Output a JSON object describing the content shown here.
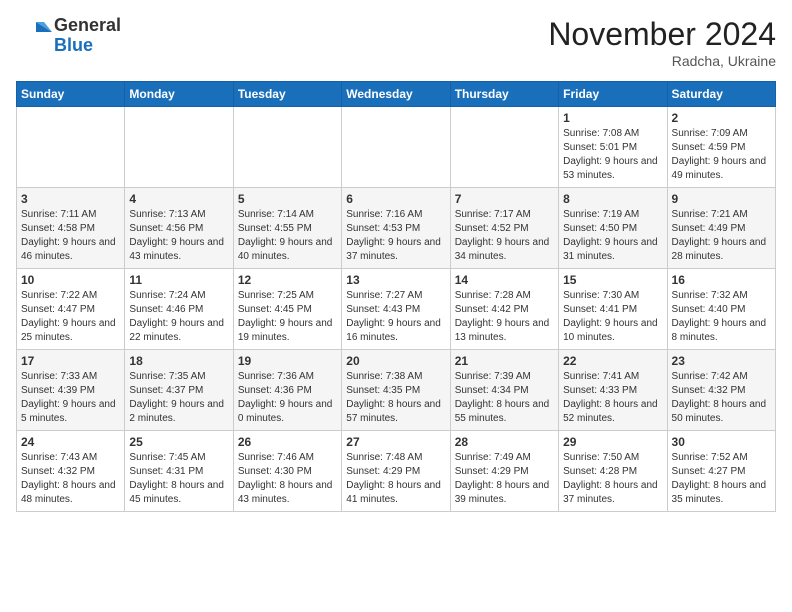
{
  "header": {
    "logo_general": "General",
    "logo_blue": "Blue",
    "month_title": "November 2024",
    "location": "Radcha, Ukraine"
  },
  "days_of_week": [
    "Sunday",
    "Monday",
    "Tuesday",
    "Wednesday",
    "Thursday",
    "Friday",
    "Saturday"
  ],
  "weeks": [
    [
      {
        "day": "",
        "info": ""
      },
      {
        "day": "",
        "info": ""
      },
      {
        "day": "",
        "info": ""
      },
      {
        "day": "",
        "info": ""
      },
      {
        "day": "",
        "info": ""
      },
      {
        "day": "1",
        "info": "Sunrise: 7:08 AM\nSunset: 5:01 PM\nDaylight: 9 hours and 53 minutes."
      },
      {
        "day": "2",
        "info": "Sunrise: 7:09 AM\nSunset: 4:59 PM\nDaylight: 9 hours and 49 minutes."
      }
    ],
    [
      {
        "day": "3",
        "info": "Sunrise: 7:11 AM\nSunset: 4:58 PM\nDaylight: 9 hours and 46 minutes."
      },
      {
        "day": "4",
        "info": "Sunrise: 7:13 AM\nSunset: 4:56 PM\nDaylight: 9 hours and 43 minutes."
      },
      {
        "day": "5",
        "info": "Sunrise: 7:14 AM\nSunset: 4:55 PM\nDaylight: 9 hours and 40 minutes."
      },
      {
        "day": "6",
        "info": "Sunrise: 7:16 AM\nSunset: 4:53 PM\nDaylight: 9 hours and 37 minutes."
      },
      {
        "day": "7",
        "info": "Sunrise: 7:17 AM\nSunset: 4:52 PM\nDaylight: 9 hours and 34 minutes."
      },
      {
        "day": "8",
        "info": "Sunrise: 7:19 AM\nSunset: 4:50 PM\nDaylight: 9 hours and 31 minutes."
      },
      {
        "day": "9",
        "info": "Sunrise: 7:21 AM\nSunset: 4:49 PM\nDaylight: 9 hours and 28 minutes."
      }
    ],
    [
      {
        "day": "10",
        "info": "Sunrise: 7:22 AM\nSunset: 4:47 PM\nDaylight: 9 hours and 25 minutes."
      },
      {
        "day": "11",
        "info": "Sunrise: 7:24 AM\nSunset: 4:46 PM\nDaylight: 9 hours and 22 minutes."
      },
      {
        "day": "12",
        "info": "Sunrise: 7:25 AM\nSunset: 4:45 PM\nDaylight: 9 hours and 19 minutes."
      },
      {
        "day": "13",
        "info": "Sunrise: 7:27 AM\nSunset: 4:43 PM\nDaylight: 9 hours and 16 minutes."
      },
      {
        "day": "14",
        "info": "Sunrise: 7:28 AM\nSunset: 4:42 PM\nDaylight: 9 hours and 13 minutes."
      },
      {
        "day": "15",
        "info": "Sunrise: 7:30 AM\nSunset: 4:41 PM\nDaylight: 9 hours and 10 minutes."
      },
      {
        "day": "16",
        "info": "Sunrise: 7:32 AM\nSunset: 4:40 PM\nDaylight: 9 hours and 8 minutes."
      }
    ],
    [
      {
        "day": "17",
        "info": "Sunrise: 7:33 AM\nSunset: 4:39 PM\nDaylight: 9 hours and 5 minutes."
      },
      {
        "day": "18",
        "info": "Sunrise: 7:35 AM\nSunset: 4:37 PM\nDaylight: 9 hours and 2 minutes."
      },
      {
        "day": "19",
        "info": "Sunrise: 7:36 AM\nSunset: 4:36 PM\nDaylight: 9 hours and 0 minutes."
      },
      {
        "day": "20",
        "info": "Sunrise: 7:38 AM\nSunset: 4:35 PM\nDaylight: 8 hours and 57 minutes."
      },
      {
        "day": "21",
        "info": "Sunrise: 7:39 AM\nSunset: 4:34 PM\nDaylight: 8 hours and 55 minutes."
      },
      {
        "day": "22",
        "info": "Sunrise: 7:41 AM\nSunset: 4:33 PM\nDaylight: 8 hours and 52 minutes."
      },
      {
        "day": "23",
        "info": "Sunrise: 7:42 AM\nSunset: 4:32 PM\nDaylight: 8 hours and 50 minutes."
      }
    ],
    [
      {
        "day": "24",
        "info": "Sunrise: 7:43 AM\nSunset: 4:32 PM\nDaylight: 8 hours and 48 minutes."
      },
      {
        "day": "25",
        "info": "Sunrise: 7:45 AM\nSunset: 4:31 PM\nDaylight: 8 hours and 45 minutes."
      },
      {
        "day": "26",
        "info": "Sunrise: 7:46 AM\nSunset: 4:30 PM\nDaylight: 8 hours and 43 minutes."
      },
      {
        "day": "27",
        "info": "Sunrise: 7:48 AM\nSunset: 4:29 PM\nDaylight: 8 hours and 41 minutes."
      },
      {
        "day": "28",
        "info": "Sunrise: 7:49 AM\nSunset: 4:29 PM\nDaylight: 8 hours and 39 minutes."
      },
      {
        "day": "29",
        "info": "Sunrise: 7:50 AM\nSunset: 4:28 PM\nDaylight: 8 hours and 37 minutes."
      },
      {
        "day": "30",
        "info": "Sunrise: 7:52 AM\nSunset: 4:27 PM\nDaylight: 8 hours and 35 minutes."
      }
    ]
  ]
}
